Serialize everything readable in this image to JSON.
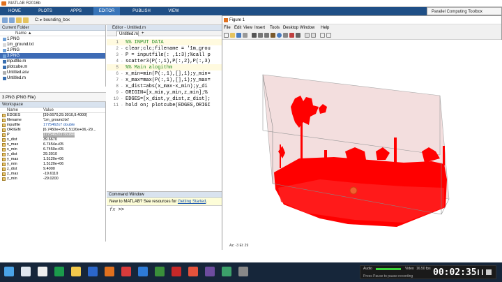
{
  "app": {
    "title": "MATLAB R2016b"
  },
  "ribbon": {
    "tabs": [
      "HOME",
      "PLOTS",
      "APPS",
      "EDITOR",
      "PUBLISH",
      "VIEW"
    ]
  },
  "toolbar": {
    "path_sep": "C:",
    "path": "bounding_box"
  },
  "current_folder": {
    "title": "Current Folder",
    "col_name": "Name",
    "col_sort": "▲",
    "files": [
      {
        "name": "1.PNG",
        "type": "png",
        "selected": false
      },
      {
        "name": "1m_ground.txt",
        "type": "txt",
        "selected": false
      },
      {
        "name": "2.PNG",
        "type": "png",
        "selected": false
      },
      {
        "name": "3.PNG",
        "type": "png",
        "selected": true
      },
      {
        "name": "inputfile.m",
        "type": "m",
        "selected": false
      },
      {
        "name": "plotcube.m",
        "type": "m",
        "selected": false
      },
      {
        "name": "Untitled.asv",
        "type": "asv",
        "selected": false
      },
      {
        "name": "Untitled.m",
        "type": "m",
        "selected": false
      }
    ],
    "detail": "3.PNG  (PNG File)"
  },
  "workspace": {
    "title": "Workspace",
    "col_name": "Name",
    "col_value": "Value",
    "rows": [
      {
        "name": "EDGES",
        "value": "[39.6670,29.3010,9.4000]",
        "style": "normal"
      },
      {
        "name": "filename",
        "value": "'1m_ground.txt'",
        "style": "normal"
      },
      {
        "name": "inputfile",
        "value": "1775462x7 double",
        "style": "link"
      },
      {
        "name": "ORIGIN",
        "value": "[6.7450e+05,1.5120e+06,-29...",
        "style": "normal"
      },
      {
        "name": "P",
        "value": "1775462x3 double",
        "style": "sel"
      },
      {
        "name": "x_dist",
        "value": "39.6670",
        "style": "normal"
      },
      {
        "name": "x_max",
        "value": "6.7454e+05",
        "style": "normal"
      },
      {
        "name": "x_min",
        "value": "6.7450e+05",
        "style": "normal"
      },
      {
        "name": "y_dist",
        "value": "29.3010",
        "style": "normal"
      },
      {
        "name": "y_max",
        "value": "1.5120e+06",
        "style": "normal"
      },
      {
        "name": "y_min",
        "value": "1.5120e+06",
        "style": "normal"
      },
      {
        "name": "z_dist",
        "value": "9.4000",
        "style": "normal"
      },
      {
        "name": "z_max",
        "value": "-19.6110",
        "style": "normal"
      },
      {
        "name": "z_min",
        "value": "-29.0200",
        "style": "normal"
      }
    ]
  },
  "editor": {
    "title": "Editor - Untitled.m",
    "tab": "Untitled.m",
    "tab_plus": "+",
    "lines": [
      {
        "n": "1",
        "dash": "",
        "text": "%% INPUT DATA",
        "kind": "cmt"
      },
      {
        "n": "2",
        "dash": "-",
        "text": "clear;clc;filename = '1m_grou",
        "kind": "code"
      },
      {
        "n": "3",
        "dash": "-",
        "text": "P = inputfile(: ,1:3);%call p",
        "kind": "code"
      },
      {
        "n": "4",
        "dash": "-",
        "text": "scatter3(P(:,1),P(:,2),P(:,3)",
        "kind": "code"
      },
      {
        "n": "5",
        "dash": "",
        "text": "%% Main alogithm",
        "kind": "cmt"
      },
      {
        "n": "6",
        "dash": "-",
        "text": "x_min=min(P(:,1),[],1);y_min=",
        "kind": "code"
      },
      {
        "n": "7",
        "dash": "-",
        "text": "x_max=max(P(:,1),[],1);y_max=",
        "kind": "code"
      },
      {
        "n": "8",
        "dash": "-",
        "text": "x_dist=abs(x_max-x_min);y_di",
        "kind": "code"
      },
      {
        "n": "9",
        "dash": "-",
        "text": "ORIGIN=[x_min,y_min,z_min];%",
        "kind": "code"
      },
      {
        "n": "10",
        "dash": "-",
        "text": "EDGES=[x_dist,y_dist,z_dist];",
        "kind": "code"
      },
      {
        "n": "11",
        "dash": "-",
        "text": "hold on; plotcube(EDGES,ORIGI",
        "kind": "code"
      }
    ]
  },
  "command_window": {
    "title": "Command Window",
    "new_to": "New to MATLAB? See resources for ",
    "link": "Getting Started",
    "link_end": ".",
    "fx": "fx",
    "prompt": ">>"
  },
  "figure": {
    "title": "Figure 1",
    "menus": [
      "File",
      "Edit",
      "View",
      "Insert",
      "Tools",
      "Desktop",
      "Window",
      "Help"
    ],
    "status": "Az: -3  El: 29"
  },
  "toolbox_dropdown": "Parallel Computing Toolbox",
  "recorder": {
    "audio": "Audio",
    "video": "Video",
    "fps": "16.50 fps",
    "time": "00:02:35",
    "hint": "Press Pause to pause recording"
  },
  "colors": {
    "ribbon": "#1f4f86",
    "cloud": "#ff0000",
    "selection": "#3e6bb5"
  }
}
